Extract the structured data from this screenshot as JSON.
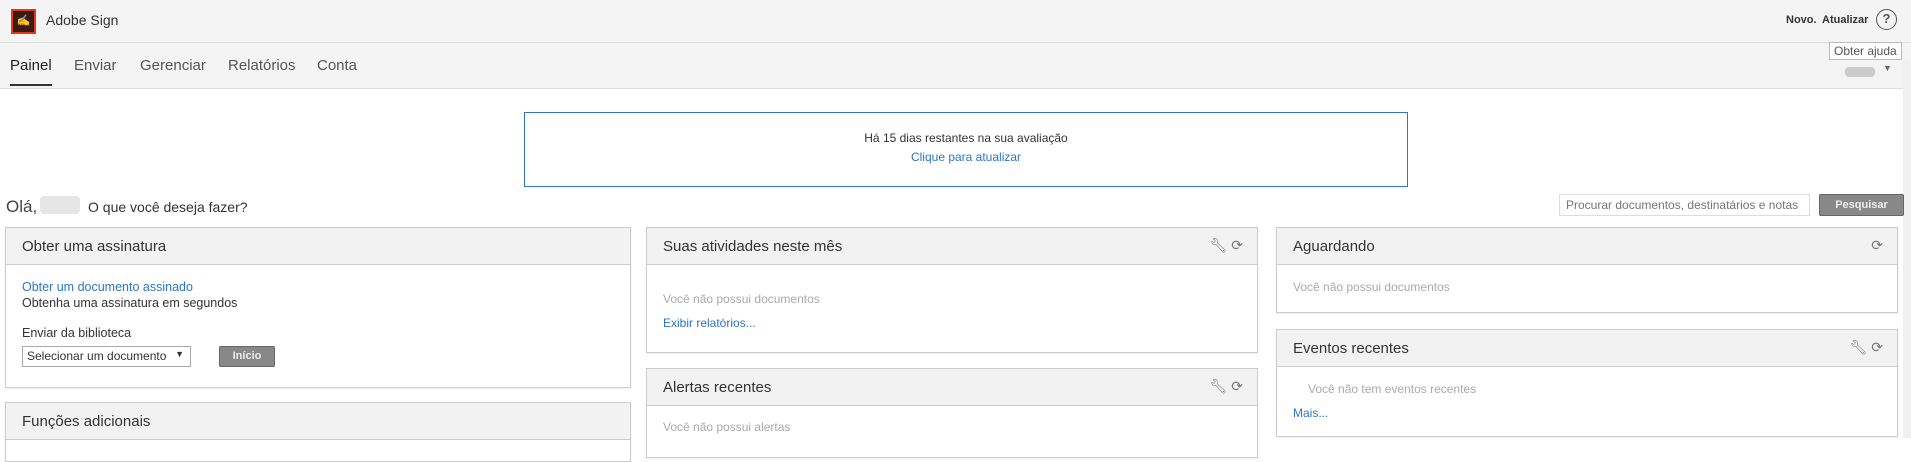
{
  "header": {
    "logo_text": "Sign",
    "app_name": "Adobe Sign",
    "novo": "Novo.",
    "atualizar": "Atualizar",
    "help_icon": "?",
    "help_tooltip": "Obter ajuda"
  },
  "nav": {
    "tabs": [
      {
        "label": "Painel"
      },
      {
        "label": "Enviar"
      },
      {
        "label": "Gerenciar"
      },
      {
        "label": "Relatórios"
      },
      {
        "label": "Conta"
      }
    ]
  },
  "trial": {
    "message": "Há 15 dias restantes na sua avaliação",
    "link": "Clique para atualizar"
  },
  "greeting": {
    "hello": "Olá,",
    "question": "O que você deseja fazer?"
  },
  "search": {
    "placeholder": "Procurar documentos, destinatários e notas",
    "button": "Pesquisar"
  },
  "panels": {
    "signature": {
      "title": "Obter uma assinatura",
      "link": "Obter um documento assinado",
      "subtitle": "Obtenha uma assinatura em segundos",
      "library_label": "Enviar da biblioteca",
      "select_value": "Selecionar um documento",
      "start_button": "Início"
    },
    "additional": {
      "title": "Funções adicionais"
    },
    "activities": {
      "title": "Suas atividades neste mês",
      "empty": "Você não possui documentos",
      "link": "Exibir relatórios..."
    },
    "alerts": {
      "title": "Alertas recentes",
      "empty": "Você não possui alertas"
    },
    "waiting": {
      "title": "Aguardando",
      "empty": "Você não possui documentos"
    },
    "events": {
      "title": "Eventos recentes",
      "empty": "Você não tem eventos recentes",
      "link": "Mais..."
    }
  },
  "colors": {
    "accent": "#2d75c9",
    "logo_border": "#e03a1a"
  }
}
